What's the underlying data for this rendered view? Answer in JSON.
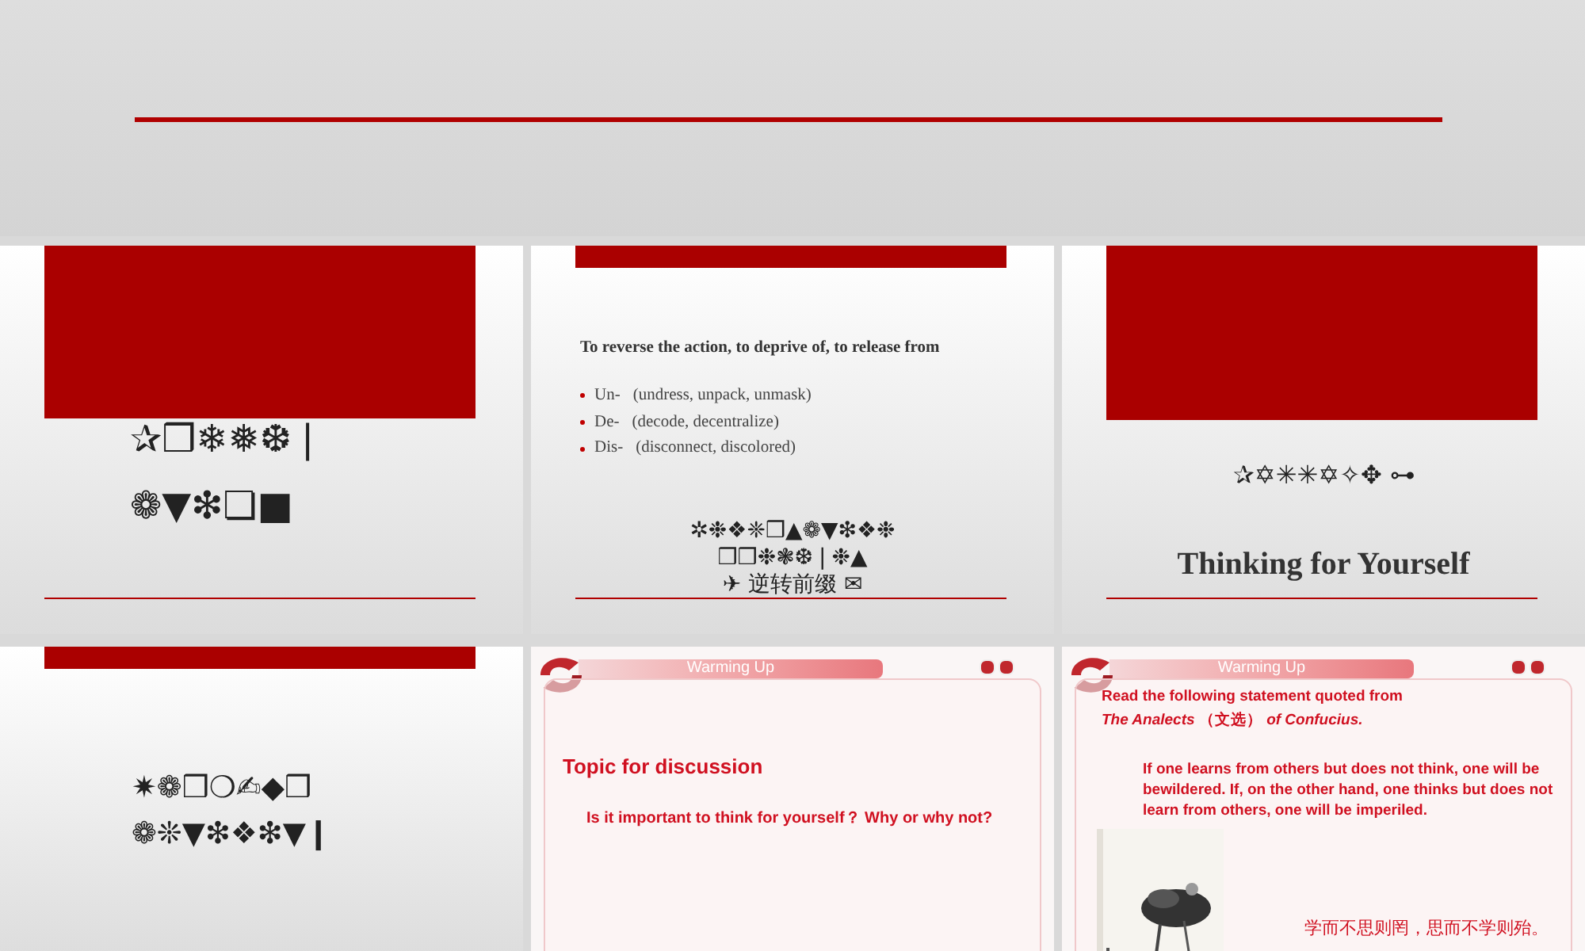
{
  "slides": [
    {
      "kind": "rule_only"
    },
    {
      "kind": "red_block",
      "glyph_lines": [
        "✰❒❄❅❆❘",
        "❁▼❇❏■"
      ]
    },
    {
      "kind": "bullets",
      "heading": "To reverse the action, to deprive of, to release from",
      "bullets": [
        {
          "prefix": "Un-",
          "text": "(undress, unpack, unmask)"
        },
        {
          "prefix": "De-",
          "text": "(decode, decentralize)"
        },
        {
          "prefix": "Dis-",
          "text": "(disconnect, discolored)"
        }
      ],
      "glyph_lines": [
        "✲❉❖❈❒▲❁▼❇❖❉",
        "❒❒❉❃❆❘❉▲",
        "✈ 逆转前缀 ✉"
      ]
    },
    {
      "kind": "red_block_title",
      "glyph_lines": [
        "✰✡✳✳✡✧✥ ⊶"
      ],
      "title": "Thinking for Yourself"
    },
    {
      "kind": "thin_bar",
      "glyph_lines": [
        "✷❁❒❍✍◆❒",
        "❁❊▼❇❖❇▼❙"
      ]
    },
    {
      "kind": "warming",
      "header": "Warming Up",
      "topic": "Topic for discussion",
      "question": "Is it important to think for yourself？  Why or why not?"
    },
    {
      "kind": "warming_quote",
      "header": "Warming Up",
      "intro": "Read the following statement quoted from",
      "source": "*The Analects* **（文选）** *of Confucius.*",
      "quote": "If one learns from others but does not think, one will be bewildered. If, on the other hand, one thinks but does not learn from others, one will be imperiled.",
      "chinese": "学而不思则罔，思而不学则殆。"
    }
  ]
}
